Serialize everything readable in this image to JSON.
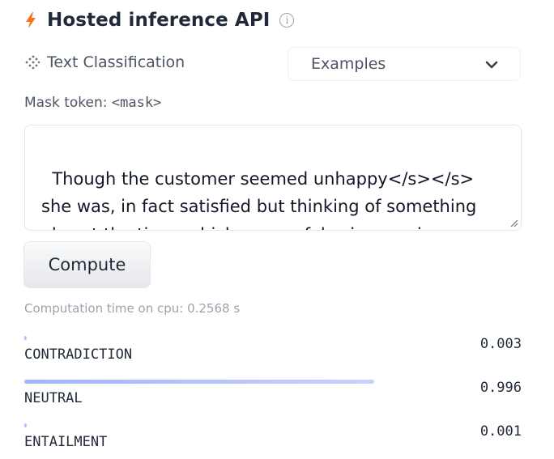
{
  "header": {
    "title": "Hosted inference API",
    "info_glyph": "i",
    "accent_color": "#f97316"
  },
  "task": {
    "label": "Text Classification",
    "icon": "text-classification-icon"
  },
  "examples": {
    "selected": "Examples"
  },
  "mask": {
    "label": "Mask token:",
    "token": "<mask>"
  },
  "input": {
    "value": "Though the customer seemed unhappy</s></s> she was, in fact satisfied but thinking of something else at the time, which gave a false impression."
  },
  "compute": {
    "label": "Compute"
  },
  "computation_time": "Computation time on cpu: 0.2568 s",
  "results": [
    {
      "label": "CONTRADICTION",
      "score_text": "0.003",
      "score": 0.003
    },
    {
      "label": "NEUTRAL",
      "score_text": "0.996",
      "score": 0.996
    },
    {
      "label": "ENTAILMENT",
      "score_text": "0.001",
      "score": 0.001
    }
  ]
}
